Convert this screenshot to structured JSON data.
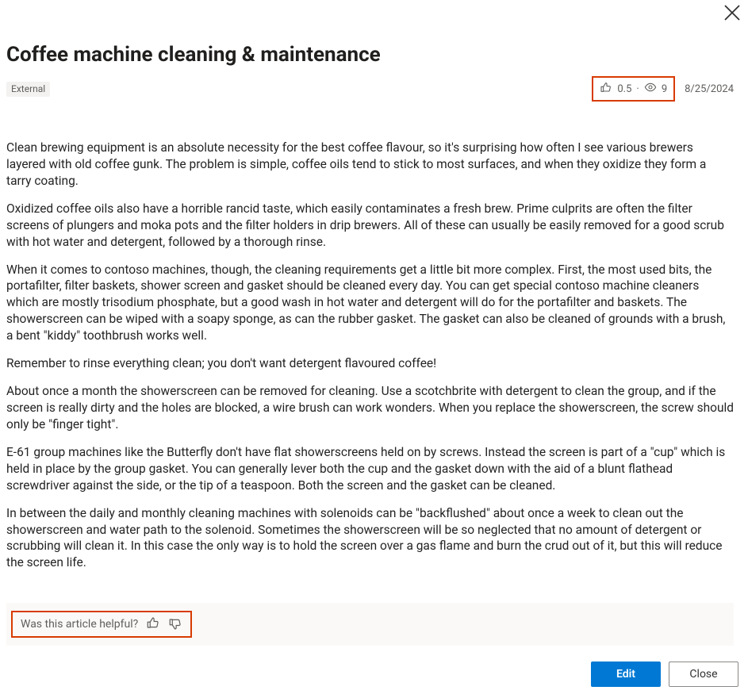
{
  "header": {
    "title": "Coffee machine cleaning & maintenance",
    "tag": "External",
    "rating": "0.5",
    "views": "9",
    "date": "8/25/2024"
  },
  "body": {
    "p1": "Clean brewing equipment is an absolute necessity for the best coffee flavour, so it's surprising how often I see various brewers layered with old coffee gunk. The problem is simple, coffee oils tend to stick to most surfaces, and when they oxidize they form a tarry coating.",
    "p2": "Oxidized coffee oils also have a horrible rancid taste, which easily contaminates a fresh brew. Prime culprits are often the filter screens of plungers and moka pots and the filter holders in drip brewers. All of these can usually be easily removed for a good scrub with hot water and detergent, followed by a thorough rinse.",
    "p3": "When it comes to contoso machines, though, the cleaning requirements get a little bit more complex. First, the most used bits, the portafilter, filter baskets, shower screen and gasket should be cleaned every day. You can get special contoso machine cleaners which are mostly trisodium phosphate, but a good wash in hot water and detergent will do for the portafilter and baskets. The showerscreen can be wiped with a soapy sponge, as can the rubber gasket. The gasket can also be cleaned of grounds with a brush, a bent \"kiddy\" toothbrush works well.",
    "p4": "Remember to rinse everything clean; you don't want detergent flavoured coffee!",
    "p5": "About once a month the showerscreen can be removed for cleaning. Use a scotchbrite with detergent to clean the group, and if the screen is really dirty and the holes are blocked, a wire brush can work wonders. When you replace the showerscreen, the screw should only be \"finger tight\".",
    "p6": "E-61 group machines like the Butterfly don't have flat showerscreens held on by screws. Instead the screen is part of a \"cup\" which is held in place by the group gasket. You can generally lever both the cup and the gasket down with the aid of a blunt flathead screwdriver against the side, or the tip of a teaspoon. Both the screen and the gasket can be cleaned.",
    "p7": "In between the daily and monthly cleaning machines with solenoids can be \"backflushed\" about once a week to clean out the showerscreen and water path to the solenoid. Sometimes the showerscreen will be so neglected that no amount of detergent or scrubbing will clean it. In this case the only way is to hold the screen over a gas flame and burn the crud out of it, but this will reduce the screen life."
  },
  "feedback": {
    "prompt": "Was this article helpful?"
  },
  "footer": {
    "edit": "Edit",
    "close": "Close"
  }
}
